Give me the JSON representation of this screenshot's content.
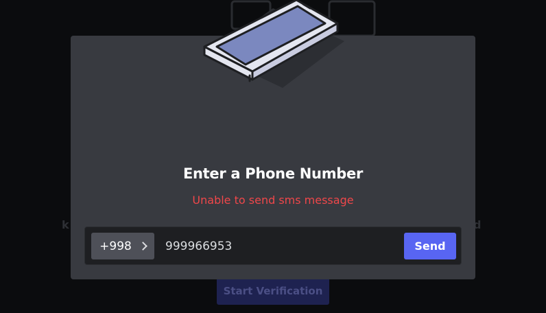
{
  "background": {
    "left_partial_text": "k",
    "right_partial_text": "d",
    "start_button_label": "Start Verification"
  },
  "modal": {
    "title": "Enter a Phone Number",
    "error_message": "Unable to send sms message",
    "country_code": "+998",
    "phone_value": "999966953",
    "send_label": "Send"
  },
  "colors": {
    "accent": "#5865f2",
    "error": "#f0474a",
    "modal_bg": "#383a40",
    "input_bg": "#1e1f22"
  },
  "icons": {
    "illustration": "phone-illustration",
    "country_chevron": "chevron-right-icon"
  }
}
